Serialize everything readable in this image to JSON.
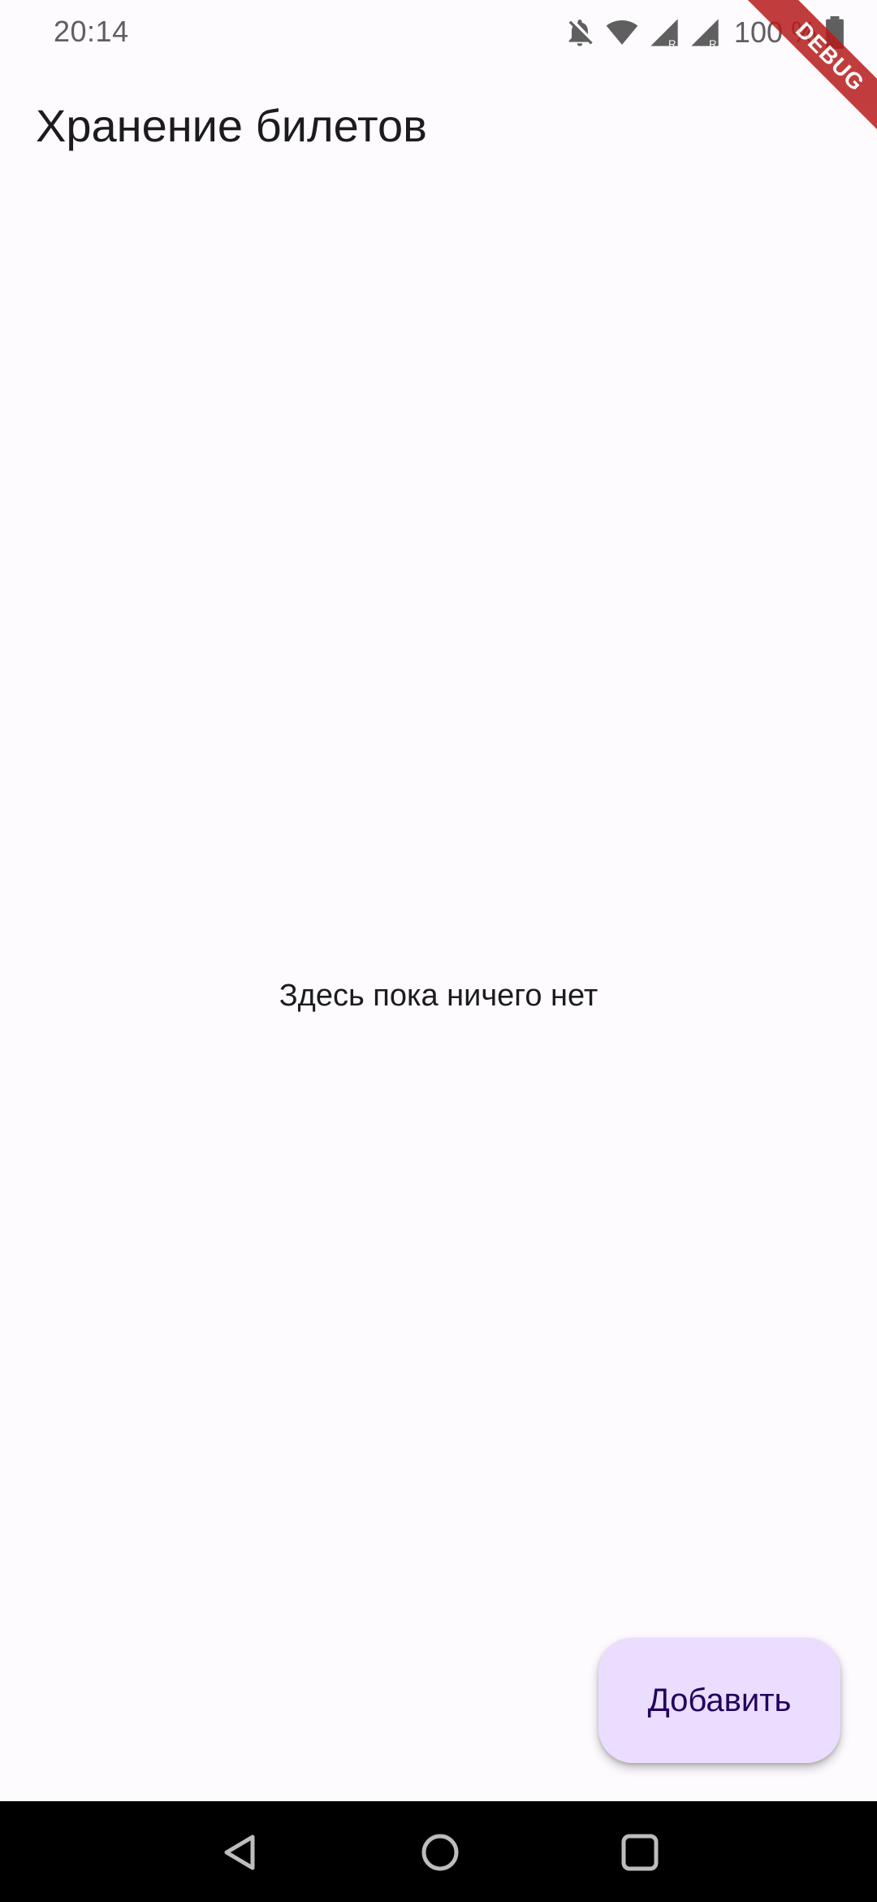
{
  "status_bar": {
    "time": "20:14",
    "battery": "100 %",
    "icons": [
      "bell-off-icon",
      "wifi-icon",
      "signal-icon",
      "signal-icon",
      "battery-icon"
    ]
  },
  "debug_banner": "DEBUG",
  "app_bar": {
    "title": "Хранение билетов"
  },
  "empty_state": {
    "message": "Здесь пока ничего нет"
  },
  "fab": {
    "label": "Добавить"
  },
  "nav_bar": {
    "buttons": [
      "back-icon",
      "home-icon",
      "recents-icon"
    ]
  },
  "colors": {
    "background": "#FEFBFF",
    "fab": "#EADDFF",
    "fab_text": "#21005D",
    "debug": "#B71C1C"
  }
}
